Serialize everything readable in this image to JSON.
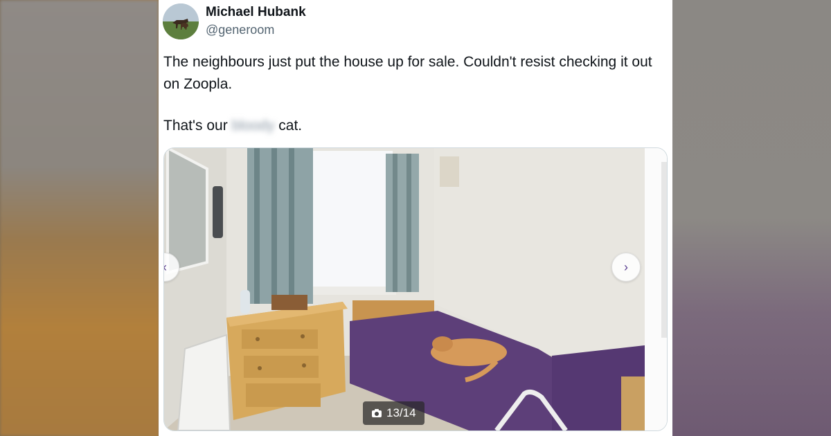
{
  "tweet": {
    "author_name": "Michael Hubank",
    "author_handle": "@generoom",
    "line1": "The neighbours just put the house up for sale. Couldn't resist checking it out on Zoopla.",
    "line2_before": "That's our ",
    "line2_redacted": "bloody",
    "line2_after": " cat."
  },
  "media": {
    "counter": "13/14",
    "camera_icon": "camera-icon",
    "next_icon": "chevron-right-icon",
    "prev_icon": "chevron-left-icon",
    "accent": "#5b3f91"
  }
}
